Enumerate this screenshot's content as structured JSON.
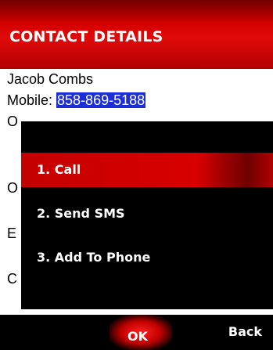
{
  "header": {
    "title": "CONTACT DETAILS"
  },
  "contact": {
    "name": "Jacob Combs",
    "mobile_label": "Mobile: ",
    "mobile_value": "858-869-5188",
    "obscured_line_initials": [
      "O",
      "O",
      "E",
      "C"
    ]
  },
  "menu": {
    "items": [
      {
        "label": "1. Call",
        "selected": true
      },
      {
        "label": "2. Send SMS",
        "selected": false
      },
      {
        "label": "3. Add To Phone",
        "selected": false
      }
    ]
  },
  "softkeys": {
    "left": "OK",
    "right": "Back"
  },
  "colors": {
    "accent": "#cc0000",
    "highlight": "#1c2ed8",
    "background": "#ffffff",
    "popup": "#000000"
  }
}
